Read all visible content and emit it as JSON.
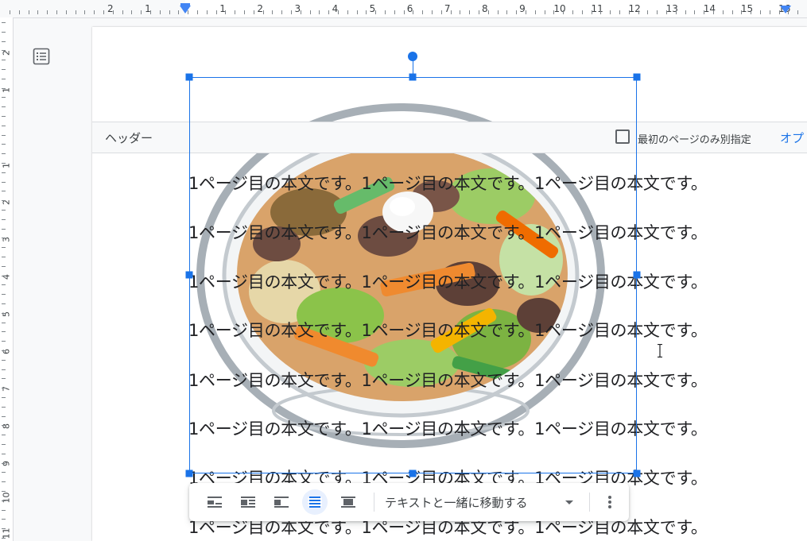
{
  "ruler": {
    "top_numbers": [
      "2",
      "1",
      "1",
      "2",
      "3",
      "4",
      "5",
      "6",
      "7",
      "8",
      "9",
      "10",
      "11",
      "12",
      "13",
      "14",
      "15",
      "16"
    ],
    "left_numbers": [
      "2",
      "1",
      "1",
      "2",
      "3",
      "4",
      "5",
      "6",
      "7",
      "8",
      "9",
      "10",
      "11"
    ]
  },
  "sidebar": {
    "outline_icon": "document-outline-icon"
  },
  "header": {
    "label": "ヘッダー",
    "first_page_checkbox_label": "最初のページのみ別指定",
    "first_page_checked": false,
    "options_label": "オプ"
  },
  "image": {
    "icon": "stir-fry-illustration",
    "selected": true
  },
  "body": {
    "lines": [
      "1ページ目の本文です。1ページ目の本文です。1ページ目の本文です。",
      "1ページ目の本文です。1ページ目の本文です。1ページ目の本文です。",
      "1ページ目の本文です。1ページ目の本文です。1ページ目の本文です。",
      "1ページ目の本文です。1ページ目の本文です。1ページ目の本文です。",
      "1ページ目の本文です。1ページ目の本文です。1ページ目の本文です。",
      "1ページ目の本文です。1ページ目の本文です。1ページ目の本文です。",
      "1ページ目の本文です。1ページ目の本文です。1ページ目の本文です。",
      "1ページ目の本文です。1ページ目の本文です。1ページ目の本文です。"
    ]
  },
  "image_toolbar": {
    "buttons": [
      "inline-wrap-icon",
      "wrap-text-icon",
      "break-text-icon",
      "behind-text-icon",
      "in-front-of-text-icon"
    ],
    "active_index": 3,
    "move_option_label": "テキストと一緒に移動する",
    "more_icon": "more-vert-icon"
  },
  "colors": {
    "accent": "#1a73e8",
    "ruler_marker": "#4285f4",
    "active_bg": "#e8f0fe"
  }
}
